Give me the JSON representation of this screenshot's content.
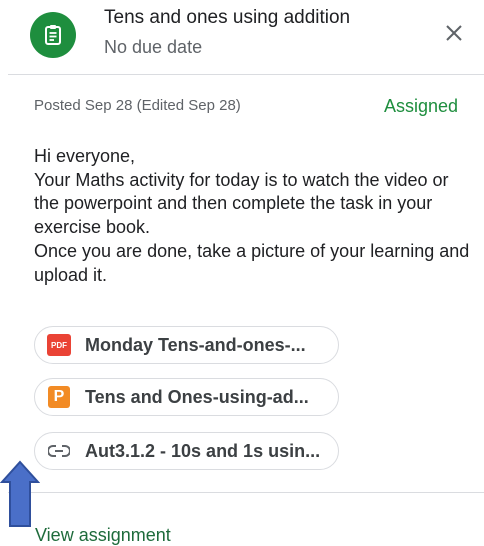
{
  "header": {
    "title": "Tens and ones using addition",
    "subtitle": "No due date",
    "icon": "assignment-icon",
    "accent_color": "#1e8e3e"
  },
  "meta": {
    "posted": "Posted Sep 28 (Edited Sep 28)",
    "status": "Assigned",
    "status_color": "#1e8e3e"
  },
  "message": {
    "lines": [
      "Hi everyone,",
      "Your Maths activity for today is to watch the video or the powerpoint and then complete the task in your exercise book.",
      "Once you are done, take a picture of your learning and upload it."
    ]
  },
  "attachments": [
    {
      "icon": "pdf-icon",
      "icon_text": "PDF",
      "label": "Monday Tens-and-ones-..."
    },
    {
      "icon": "powerpoint-icon",
      "icon_text": "P",
      "label": "Tens and Ones-using-ad..."
    },
    {
      "icon": "link-icon",
      "label": "Aut3.1.2 - 10s and 1s usin..."
    }
  ],
  "footer": {
    "link_label": "View assignment"
  }
}
